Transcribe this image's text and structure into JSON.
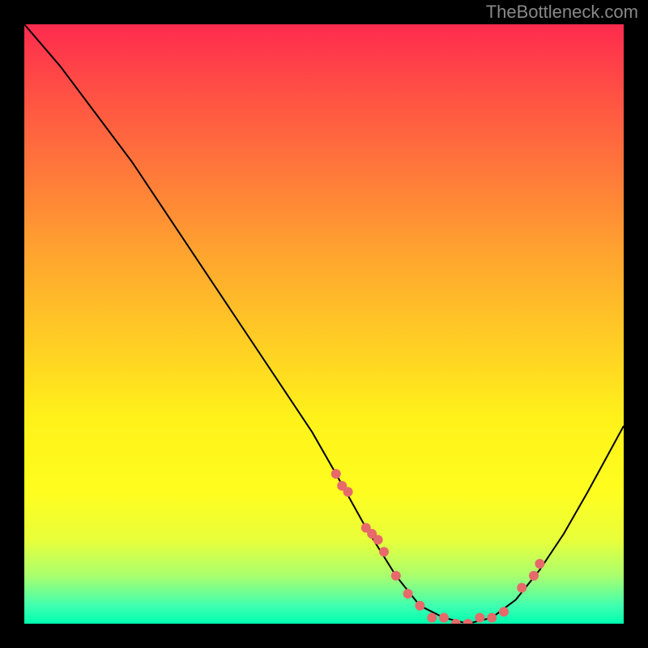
{
  "watermark": "TheBottleneck.com",
  "chart_data": {
    "type": "line",
    "title": "",
    "xlabel": "",
    "ylabel": "",
    "xlim": [
      0,
      100
    ],
    "ylim": [
      0,
      100
    ],
    "series": [
      {
        "name": "bottleneck-curve",
        "x": [
          0,
          6,
          12,
          18,
          24,
          30,
          36,
          42,
          48,
          52,
          57,
          62,
          66,
          70,
          74,
          78,
          82,
          86,
          90,
          94,
          100
        ],
        "values": [
          100,
          93,
          85,
          77,
          68,
          59,
          50,
          41,
          32,
          25,
          16,
          8,
          3,
          1,
          0,
          1,
          4,
          9,
          15,
          22,
          33
        ]
      }
    ],
    "markers": {
      "x": [
        52,
        53,
        54,
        57,
        58,
        59,
        60,
        62,
        64,
        66,
        68,
        70,
        72,
        74,
        76,
        78,
        80,
        83,
        85,
        86
      ],
      "values": [
        25,
        23,
        22,
        16,
        15,
        14,
        12,
        8,
        5,
        3,
        1,
        1,
        0,
        0,
        1,
        1,
        2,
        6,
        8,
        10
      ],
      "color": "#e66a6a"
    },
    "background_gradient": {
      "top": "#ff2b4e",
      "middle": "#fff21a",
      "bottom": "#00ffb0"
    }
  }
}
